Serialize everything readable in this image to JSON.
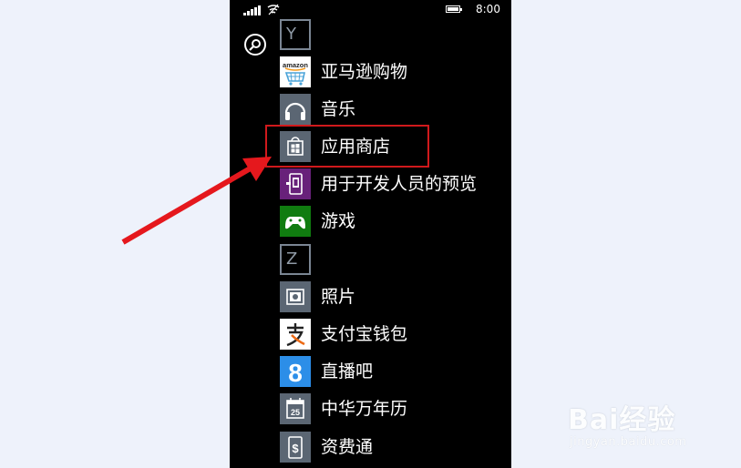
{
  "status": {
    "time": "8:00"
  },
  "sections": [
    {
      "letter": "Y"
    },
    {
      "letter": "Z"
    }
  ],
  "apps": [
    {
      "label": "亚马逊购物",
      "icon": "amazon-icon",
      "bg": "#ffffff",
      "logo": "amazon"
    },
    {
      "label": "音乐",
      "icon": "headphones-icon",
      "bg": "#5b6673"
    },
    {
      "label": "应用商店",
      "icon": "store-bag-icon",
      "bg": "#5b6673"
    },
    {
      "label": "用于开发人员的预览",
      "icon": "developer-phone-icon",
      "bg": "#68217a"
    },
    {
      "label": "游戏",
      "icon": "xbox-controller-icon",
      "bg": "#107c10"
    },
    {
      "label": "照片",
      "icon": "camera-icon",
      "bg": "#5b6673"
    },
    {
      "label": "支付宝钱包",
      "icon": "alipay-icon",
      "bg": "#ffffff"
    },
    {
      "label": "直播吧",
      "icon": "number-eight-icon",
      "bg": "#2c8ee8",
      "glyph": "8"
    },
    {
      "label": "中华万年历",
      "icon": "calendar-icon",
      "bg": "#5b6673",
      "glyph": "25"
    },
    {
      "label": "资费通",
      "icon": "dollar-phone-icon",
      "bg": "#5b6673"
    }
  ],
  "colors": {
    "highlight": "#d0191c",
    "arrow": "#e5181d"
  },
  "watermark": {
    "brand": "Bai经验",
    "url": "jingyan.baidu.com"
  }
}
